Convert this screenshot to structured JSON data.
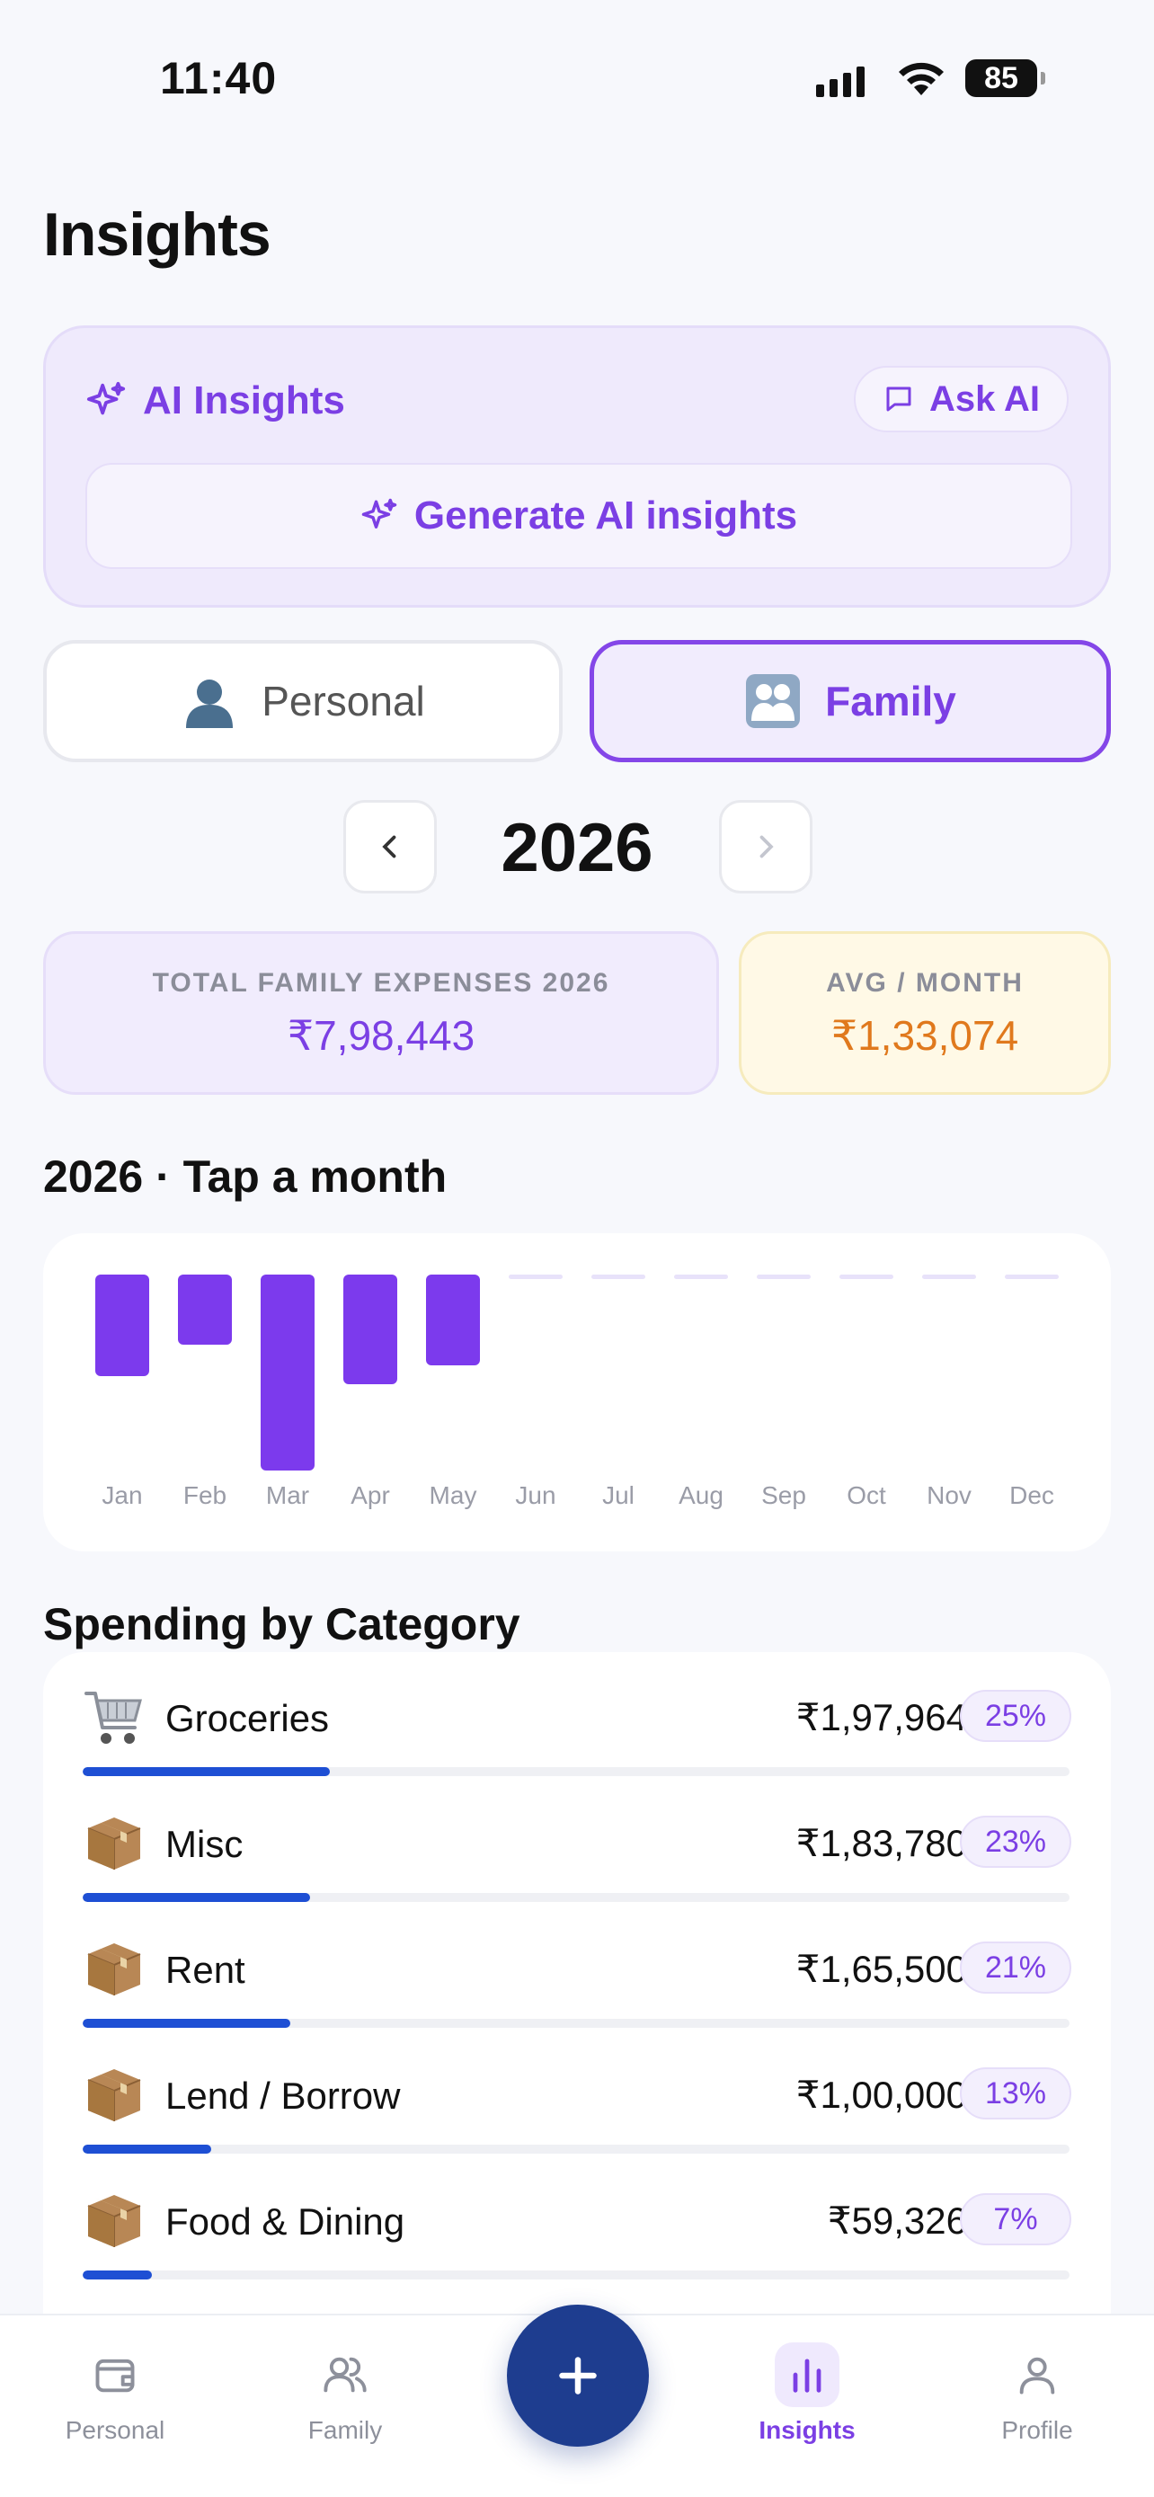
{
  "status": {
    "time": "11:40",
    "battery": "85"
  },
  "page": {
    "title": "Insights"
  },
  "ai_card": {
    "title": "AI Insights",
    "ask_label": "Ask AI",
    "generate_label": "Generate AI insights"
  },
  "toggle": {
    "personal_label": "Personal",
    "family_label": "Family",
    "selected": "Family"
  },
  "year_nav": {
    "year": "2026"
  },
  "summary": {
    "total_label": "TOTAL FAMILY EXPENSES 2026",
    "total_value": "₹7,98,443",
    "avg_label": "AVG / MONTH",
    "avg_value": "₹1,33,074"
  },
  "chart_section": {
    "title": "2026 · Tap a month"
  },
  "chart_data": {
    "type": "bar",
    "categories": [
      "Jan",
      "Feb",
      "Mar",
      "Apr",
      "May",
      "Jun",
      "Jul",
      "Aug",
      "Sep",
      "Oct",
      "Nov",
      "Dec"
    ],
    "values": [
      137000,
      95000,
      265000,
      148000,
      123000,
      0,
      0,
      0,
      0,
      0,
      0,
      0
    ],
    "ylim": [
      0,
      265000
    ],
    "grid": false,
    "colors": {
      "bar": "#7c3aed",
      "empty": "#e8e2fa"
    }
  },
  "categories_section": {
    "title": "Spending by Category",
    "items": [
      {
        "icon": "shopping-cart",
        "name": "Groceries",
        "amount": "₹1,97,964",
        "percent": "25%",
        "share": 0.25
      },
      {
        "icon": "package",
        "name": "Misc",
        "amount": "₹1,83,780",
        "percent": "23%",
        "share": 0.23
      },
      {
        "icon": "package",
        "name": "Rent",
        "amount": "₹1,65,500",
        "percent": "21%",
        "share": 0.21
      },
      {
        "icon": "package",
        "name": "Lend / Borrow",
        "amount": "₹1,00,000",
        "percent": "13%",
        "share": 0.13
      },
      {
        "icon": "package",
        "name": "Food & Dining",
        "amount": "₹59,326",
        "percent": "7%",
        "share": 0.07
      }
    ]
  },
  "tab_bar": {
    "tabs": [
      {
        "label": "Personal",
        "icon": "wallet"
      },
      {
        "label": "Family",
        "icon": "users"
      },
      {
        "label": "Insights",
        "icon": "bar-chart",
        "active": true
      },
      {
        "label": "Profile",
        "icon": "user"
      }
    ],
    "fab_icon": "plus"
  },
  "colors": {
    "accent": "#7b3fe4",
    "progress": "#1e4fd4",
    "fab": "#1e3d8f",
    "avg": "#e0791d"
  }
}
